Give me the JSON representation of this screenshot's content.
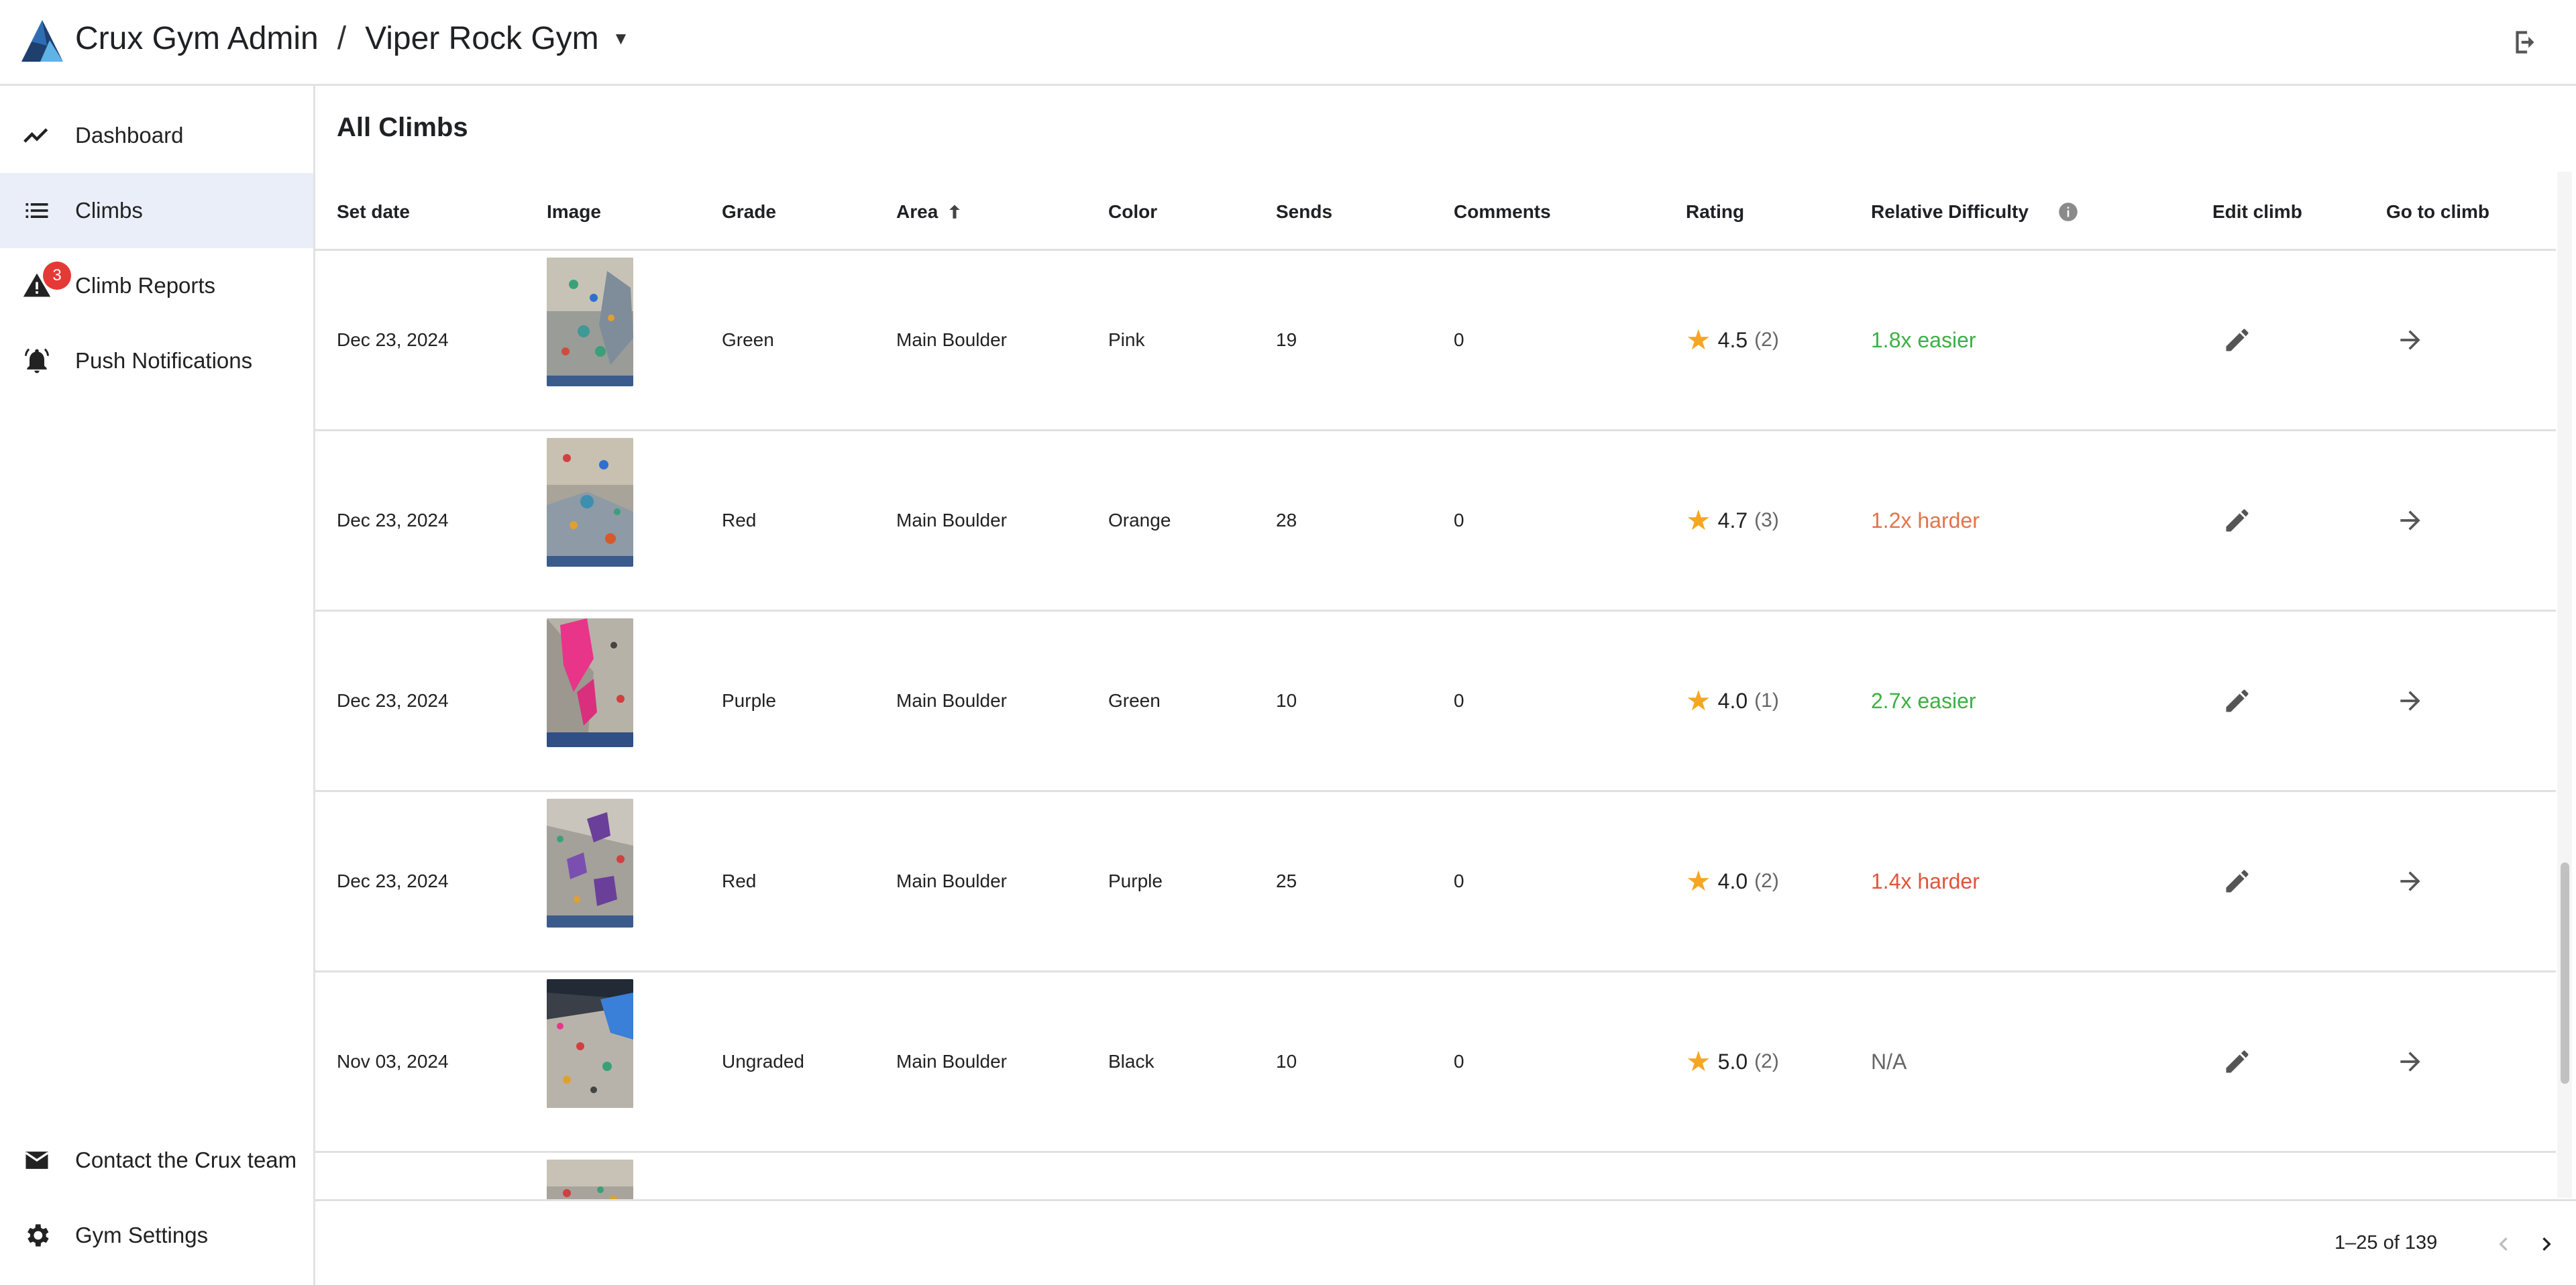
{
  "app": {
    "title": "Crux Gym Admin",
    "separator": "/",
    "gym_name": "Viper Rock Gym",
    "gym_caret": "▼",
    "logo_icon": "crux-logo-icon",
    "logout_icon": "logout-icon"
  },
  "sidebar": {
    "items": [
      {
        "label": "Dashboard",
        "icon": "trending-line-icon"
      },
      {
        "label": "Climbs",
        "icon": "list-icon",
        "active": true
      },
      {
        "label": "Climb Reports",
        "icon": "warning-icon",
        "badge": "3"
      },
      {
        "label": "Push Notifications",
        "icon": "bell-icon"
      }
    ],
    "bottom_items": [
      {
        "label": "Contact the Crux team",
        "icon": "mail-icon"
      },
      {
        "label": "Gym Settings",
        "icon": "gear-icon"
      }
    ]
  },
  "main": {
    "title": "All Climbs",
    "columns": {
      "set_date": "Set date",
      "image": "Image",
      "grade": "Grade",
      "area": "Area",
      "area_sort_icon": "arrow-up-icon",
      "color": "Color",
      "sends": "Sends",
      "comments": "Comments",
      "rating": "Rating",
      "relative_difficulty": "Relative Difficulty",
      "info_icon": "info-icon",
      "edit_climb": "Edit climb",
      "go_to_climb": "Go to climb"
    },
    "rows": [
      {
        "set_date": "Dec 23, 2024",
        "grade": "Green",
        "area": "Main Boulder",
        "color": "Pink",
        "sends": "19",
        "comments": "0",
        "rating": "4.5",
        "rating_count": "(2)",
        "difficulty": "1.8x easier",
        "difficulty_color": "#3cb043"
      },
      {
        "set_date": "Dec 23, 2024",
        "grade": "Red",
        "area": "Main Boulder",
        "color": "Orange",
        "sends": "28",
        "comments": "0",
        "rating": "4.7",
        "rating_count": "(3)",
        "difficulty": "1.2x harder",
        "difficulty_color": "#e0744a"
      },
      {
        "set_date": "Dec 23, 2024",
        "grade": "Purple",
        "area": "Main Boulder",
        "color": "Green",
        "sends": "10",
        "comments": "0",
        "rating": "4.0",
        "rating_count": "(1)",
        "difficulty": "2.7x easier",
        "difficulty_color": "#3cb043"
      },
      {
        "set_date": "Dec 23, 2024",
        "grade": "Red",
        "area": "Main Boulder",
        "color": "Purple",
        "sends": "25",
        "comments": "0",
        "rating": "4.0",
        "rating_count": "(2)",
        "difficulty": "1.4x harder",
        "difficulty_color": "#e0553a"
      },
      {
        "set_date": "Nov 03, 2024",
        "grade": "Ungraded",
        "area": "Main Boulder",
        "color": "Black",
        "sends": "10",
        "comments": "0",
        "rating": "5.0",
        "rating_count": "(2)",
        "difficulty": "N/A",
        "difficulty_color": "#666666"
      }
    ]
  },
  "pagination": {
    "range_text": "1–25 of 139",
    "prev_icon": "chevron-left-icon",
    "next_icon": "chevron-right-icon"
  },
  "colors": {
    "accent_active_bg": "#eaeef8",
    "star": "#f5a623",
    "badge": "#e53935"
  }
}
